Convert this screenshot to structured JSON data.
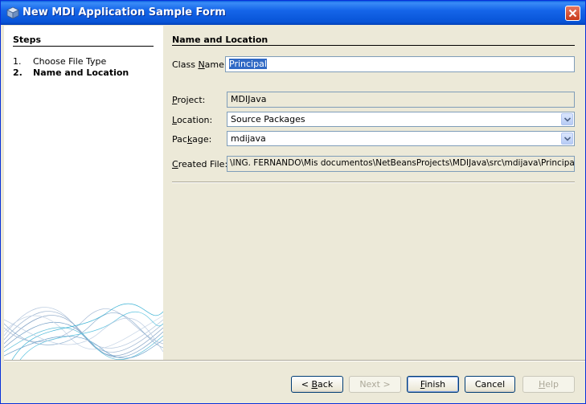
{
  "window": {
    "title": "New MDI Application Sample Form"
  },
  "steps": {
    "title": "Steps",
    "items": [
      {
        "num": "1.",
        "label": "Choose File Type"
      },
      {
        "num": "2.",
        "label": "Name and Location"
      }
    ]
  },
  "main": {
    "title": "Name and Location",
    "class_name": {
      "label_pre": "Class ",
      "label_u": "N",
      "label_post": "ame:",
      "value": "Principal"
    },
    "project": {
      "label_pre": "",
      "label_u": "P",
      "label_post": "roject:",
      "value": "MDIJava"
    },
    "location": {
      "label_pre": "",
      "label_u": "L",
      "label_post": "ocation:",
      "value": "Source Packages"
    },
    "package": {
      "label_pre": "Pac",
      "label_u": "k",
      "label_post": "age:",
      "value": "mdijava"
    },
    "created_file": {
      "label_pre": "",
      "label_u": "C",
      "label_post": "reated File:",
      "value": "\\ING. FERNANDO\\Mis documentos\\NetBeansProjects\\MDIJava\\src\\mdijava\\Principal.java"
    }
  },
  "buttons": {
    "back": {
      "pre": "< ",
      "u": "B",
      "post": "ack"
    },
    "next": "Next >",
    "finish": {
      "u": "F",
      "post": "inish"
    },
    "cancel": "Cancel",
    "help": {
      "u": "H",
      "post": "elp"
    }
  },
  "colors": {
    "title_bar": "#0854d7",
    "selection": "#316ac5",
    "dialog_bg": "#ece9d8"
  }
}
